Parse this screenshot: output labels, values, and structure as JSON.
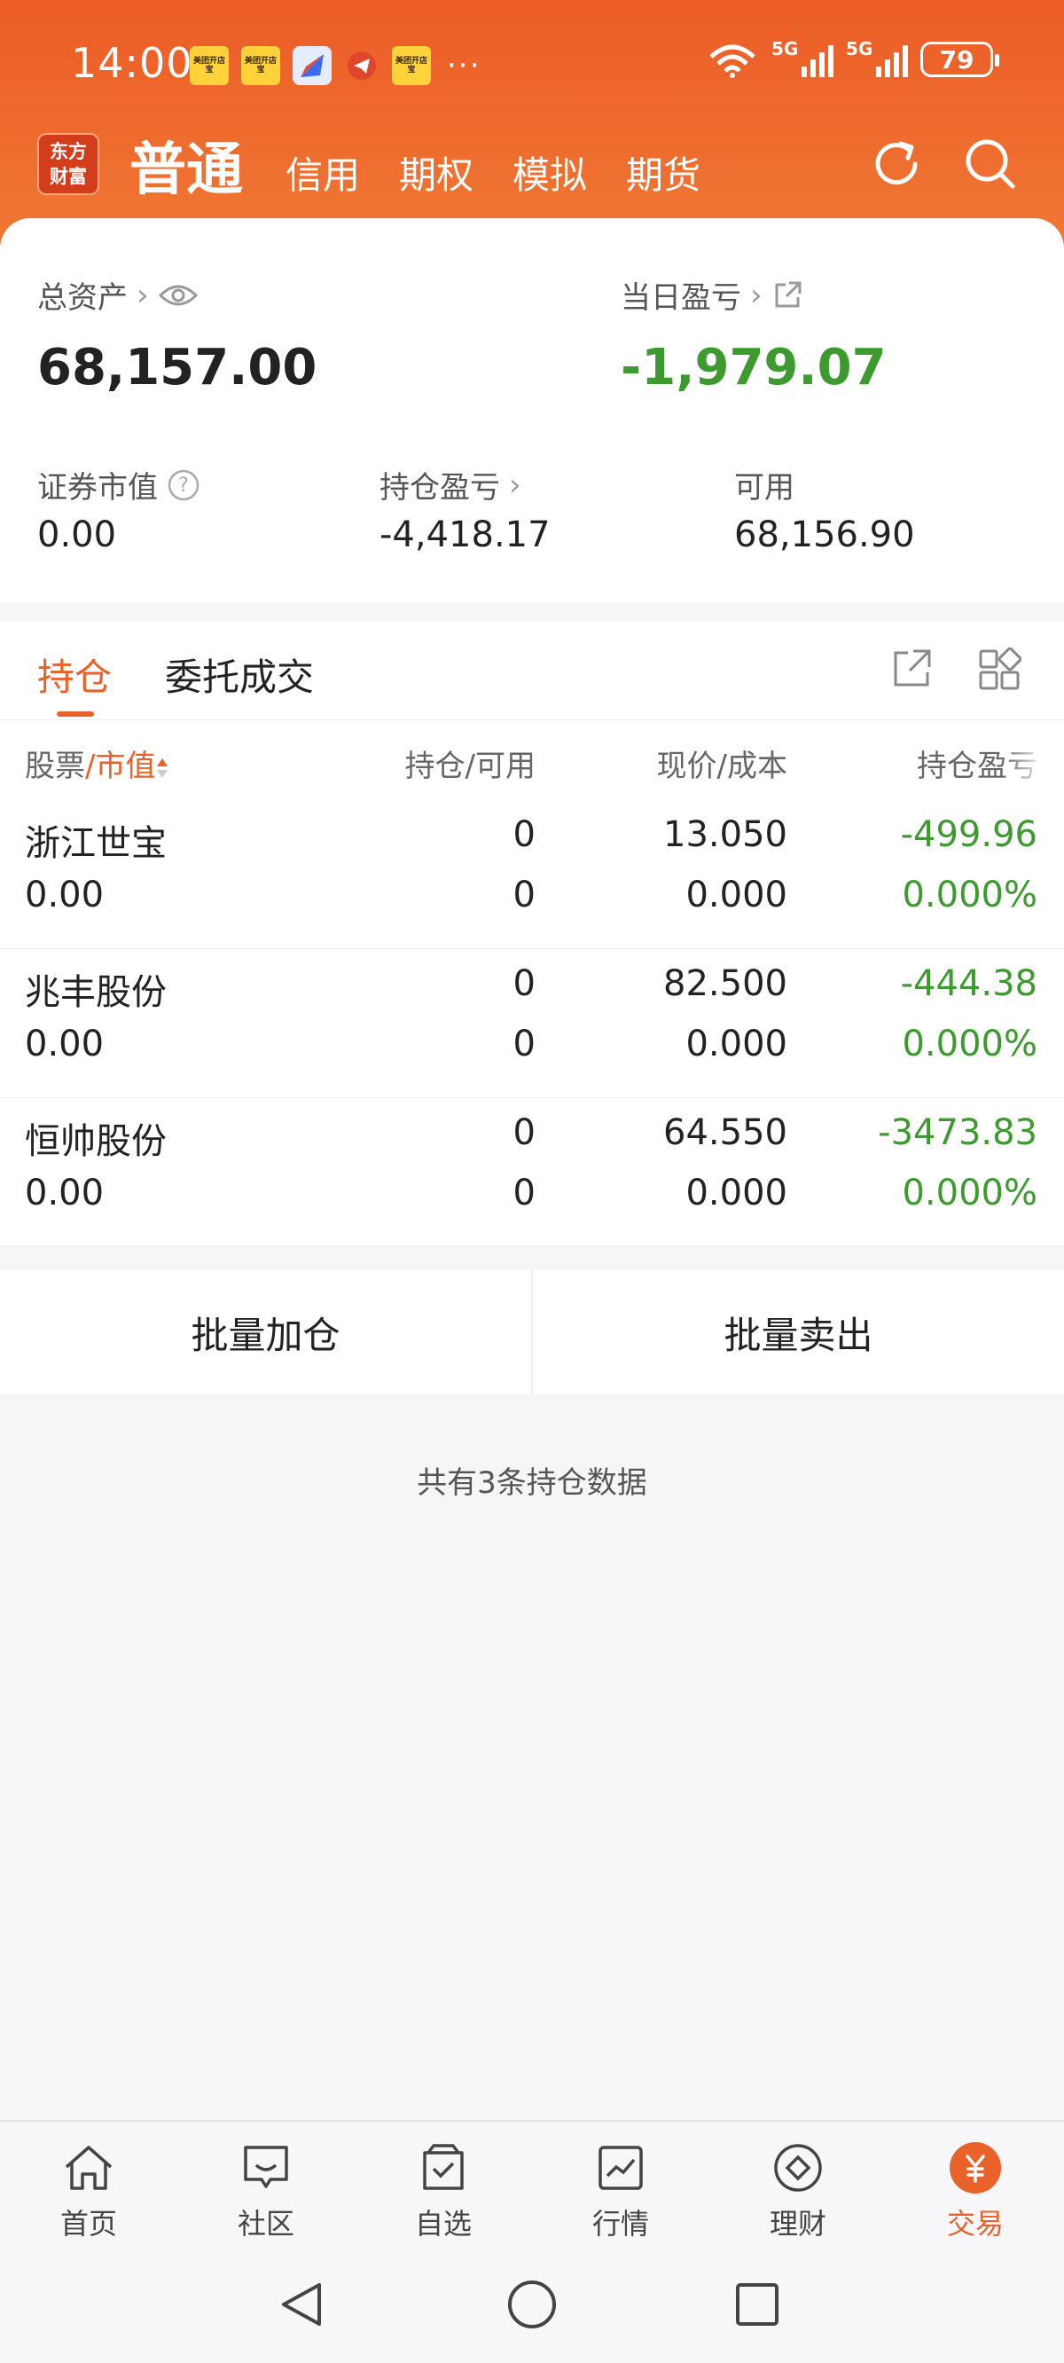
{
  "status": {
    "time": "14:00",
    "notif_label": "美团开店宝",
    "battery": "79",
    "net1": "5G",
    "net2": "5G"
  },
  "nav": {
    "logo_line1": "东方",
    "logo_line2": "财富",
    "main": "普通",
    "tabs": [
      "信用",
      "期权",
      "模拟",
      "期货"
    ]
  },
  "assets": {
    "total_label": "总资产",
    "total_value": "68,157.00",
    "daily_label": "当日盈亏",
    "daily_value": "-1,979.07",
    "market_label": "证券市值",
    "market_value": "0.00",
    "holding_pl_label": "持仓盈亏",
    "holding_pl_value": "-4,418.17",
    "available_label": "可用",
    "available_value": "68,156.90"
  },
  "tabs": {
    "positions": "持仓",
    "orders": "委托成交"
  },
  "table": {
    "col1a": "股票",
    "col1sep": "/",
    "col1b": "市值",
    "col2": "持仓/可用",
    "col3": "现价/成本",
    "col4": "持仓盈亏",
    "rows": [
      {
        "name": "浙江世宝",
        "mv": "0.00",
        "hold": "0",
        "avail": "0",
        "price": "13.050",
        "cost": "0.000",
        "pl": "-499.96",
        "pct": "0.000%"
      },
      {
        "name": "兆丰股份",
        "mv": "0.00",
        "hold": "0",
        "avail": "0",
        "price": "82.500",
        "cost": "0.000",
        "pl": "-444.38",
        "pct": "0.000%"
      },
      {
        "name": "恒帅股份",
        "mv": "0.00",
        "hold": "0",
        "avail": "0",
        "price": "64.550",
        "cost": "0.000",
        "pl": "-3473.83",
        "pct": "0.000%"
      }
    ]
  },
  "batch": {
    "add": "批量加仓",
    "sell": "批量卖出"
  },
  "summary": "共有3条持仓数据",
  "bottomnav": [
    "首页",
    "社区",
    "自选",
    "行情",
    "理财",
    "交易"
  ],
  "colors": {
    "brand": "#ec5c27",
    "accent": "#e8622a",
    "loss_green": "#3c9a2f"
  }
}
